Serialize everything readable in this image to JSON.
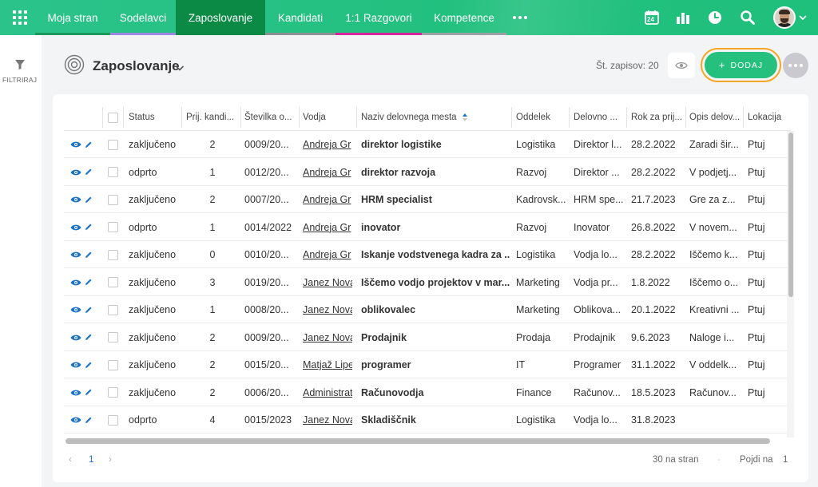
{
  "nav": {
    "items": [
      {
        "label": "Moja stran",
        "active": false,
        "underline": "#1a9a5a"
      },
      {
        "label": "Sodelavci",
        "active": false,
        "underline": "#9b86e0"
      },
      {
        "label": "Zaposlovanje",
        "active": true,
        "underline": "#0a8a44"
      },
      {
        "label": "Kandidati",
        "active": false,
        "underline": "#8a8f92"
      },
      {
        "label": "1:1 Razgovori",
        "active": false,
        "underline": "#d6249d"
      },
      {
        "label": "Kompetence",
        "active": false,
        "underline": "#9aa0a3"
      }
    ],
    "calendar_day": "24",
    "icons": [
      "apps-grid-icon",
      "more-dots-icon",
      "calendar-icon",
      "bar-chart-icon",
      "clock-icon",
      "search-icon",
      "avatar",
      "chevron-down-icon"
    ]
  },
  "left": {
    "filter_label": "FILTRIRAJ"
  },
  "page": {
    "title": "Zaposlovanje",
    "count_label": "Št. zapisov: 20",
    "add_label": "DODAJ",
    "add_symbol": "+"
  },
  "table": {
    "headers": [
      "Status",
      "Prij. kandi...",
      "Številka o...",
      "Vodja",
      "Naziv delovnega mesta",
      "Oddelek",
      "Delovno ...",
      "Rok za prij...",
      "Opis delov...",
      "Lokacija"
    ],
    "rows": [
      [
        "zaključeno",
        "2",
        "0009/20...",
        "Andreja Gr",
        "direktor logistike",
        "Logistika",
        "Direktor l...",
        "28.2.2022",
        "Zaradi šir...",
        "Ptuj"
      ],
      [
        "odprto",
        "1",
        "0012/20...",
        "Andreja Gr",
        "direktor razvoja",
        "Razvoj",
        "Direktor ...",
        "28.2.2022",
        "V podjetj...",
        "Ptuj"
      ],
      [
        "zaključeno",
        "2",
        "0007/20...",
        "Andreja Gr",
        "HRM specialist",
        "Kadrovsk...",
        "HRM spe...",
        "21.7.2023",
        "Gre za z...",
        "Ptuj"
      ],
      [
        "odprto",
        "1",
        "0014/2022",
        "Andreja Gr",
        "inovator",
        "Razvoj",
        "Inovator",
        "26.8.2022",
        "V novem...",
        "Ptuj"
      ],
      [
        "zaključeno",
        "0",
        "0010/20...",
        "Andreja Gr",
        "Iskanje vodstvenega kadra za ...",
        "Logistika",
        "Vodja lo...",
        "28.2.2022",
        "Iščemo k...",
        "Ptuj"
      ],
      [
        "zaključeno",
        "3",
        "0019/20...",
        "Janez Nova",
        "Iščemo vodjo projektov v mar...",
        "Marketing",
        "Vodja pr...",
        "1.8.2022",
        "Iščemo o...",
        "Ptuj"
      ],
      [
        "zaključeno",
        "1",
        "0008/20...",
        "Janez Nova",
        "oblikovalec",
        "Marketing",
        "Oblikova...",
        "20.1.2022",
        "Kreativni ...",
        "Ptuj"
      ],
      [
        "zaključeno",
        "2",
        "0009/20...",
        "Janez Nova",
        "Prodajnik",
        "Prodaja",
        "Prodajnik",
        "9.6.2023",
        "Naloge i...",
        "Ptuj"
      ],
      [
        "zaključeno",
        "2",
        "0015/20...",
        "Matjaž Lipe",
        "programer",
        "IT",
        "Programer",
        "31.1.2022",
        "V oddelk...",
        "Ptuj"
      ],
      [
        "zaključeno",
        "2",
        "0006/20...",
        "Administrat",
        "Računovodja",
        "Finance",
        "Računov...",
        "18.5.2023",
        "Računov...",
        "Ptuj"
      ],
      [
        "odprto",
        "4",
        "0015/2023",
        "Janez Nova",
        "Skladiščnik",
        "Logistika",
        "Vodja lo...",
        "31.8.2023",
        "",
        ""
      ]
    ]
  },
  "pager": {
    "page": "1",
    "per_page": "30 na stran",
    "goto_label": "Pojdi na",
    "goto_value": "1"
  },
  "colors": {
    "accent": "#25c07e",
    "highlight_ring": "#f6a623",
    "row_icon": "#1a73c9"
  }
}
